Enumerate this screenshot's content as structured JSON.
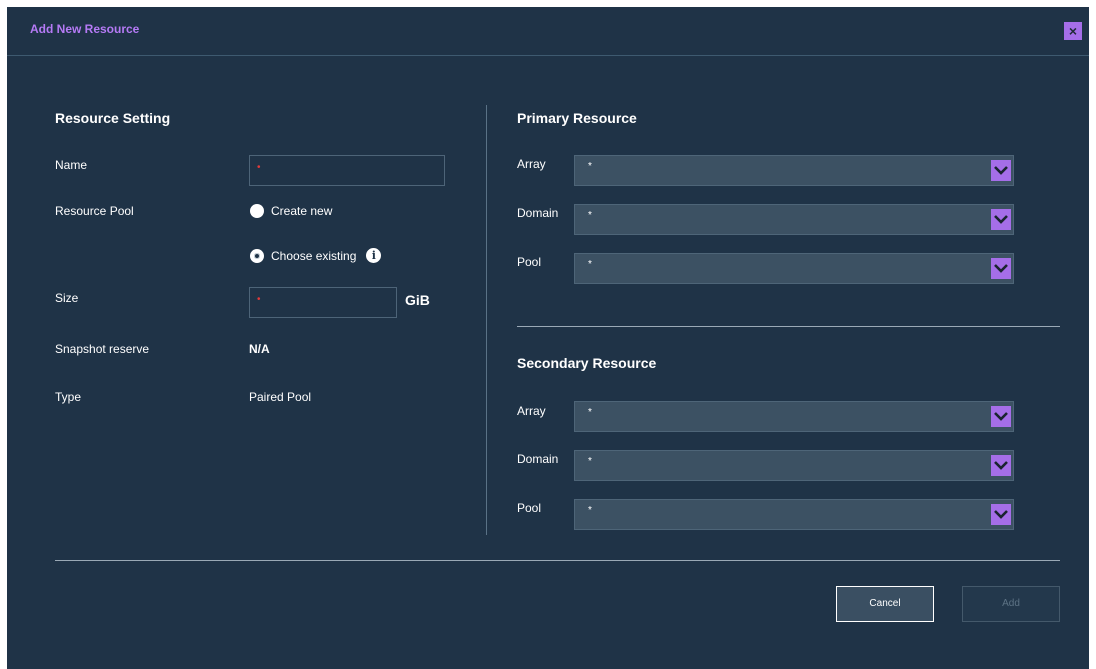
{
  "dialog": {
    "title": "Add New Resource",
    "close_label": "×"
  },
  "resource_setting": {
    "title": "Resource Setting",
    "name_label": "Name",
    "name_value": "",
    "name_required_mark": "•",
    "pool_label": "Resource Pool",
    "pool_options": [
      "Create new",
      "Choose existing"
    ],
    "pool_selected": "Choose existing",
    "info_icon_glyph": "i",
    "size_label": "Size",
    "size_value": "",
    "size_required_mark": "•",
    "size_unit": "GiB",
    "snapshot_label": "Snapshot reserve",
    "snapshot_value": "N/A",
    "type_label": "Type",
    "type_value": "Paired Pool"
  },
  "primary_resource": {
    "title": "Primary Resource",
    "fields": [
      {
        "label": "Array",
        "value": "*"
      },
      {
        "label": "Domain",
        "value": "*"
      },
      {
        "label": "Pool",
        "value": "*"
      }
    ]
  },
  "secondary_resource": {
    "title": "Secondary Resource",
    "fields": [
      {
        "label": "Array",
        "value": "*"
      },
      {
        "label": "Domain",
        "value": "*"
      },
      {
        "label": "Pool",
        "value": "*"
      }
    ]
  },
  "footer": {
    "cancel_label": "Cancel",
    "add_label": "Add",
    "add_enabled": false
  },
  "colors": {
    "dialog_bg": "#1f3347",
    "accent_purple": "#a56ee8",
    "title_purple": "#b57af5",
    "select_bg": "#3c5163",
    "required_red": "#e03a3a"
  },
  "icons": {
    "close": "close-icon",
    "dropdown": "chevron-down-icon",
    "info": "info-icon"
  }
}
